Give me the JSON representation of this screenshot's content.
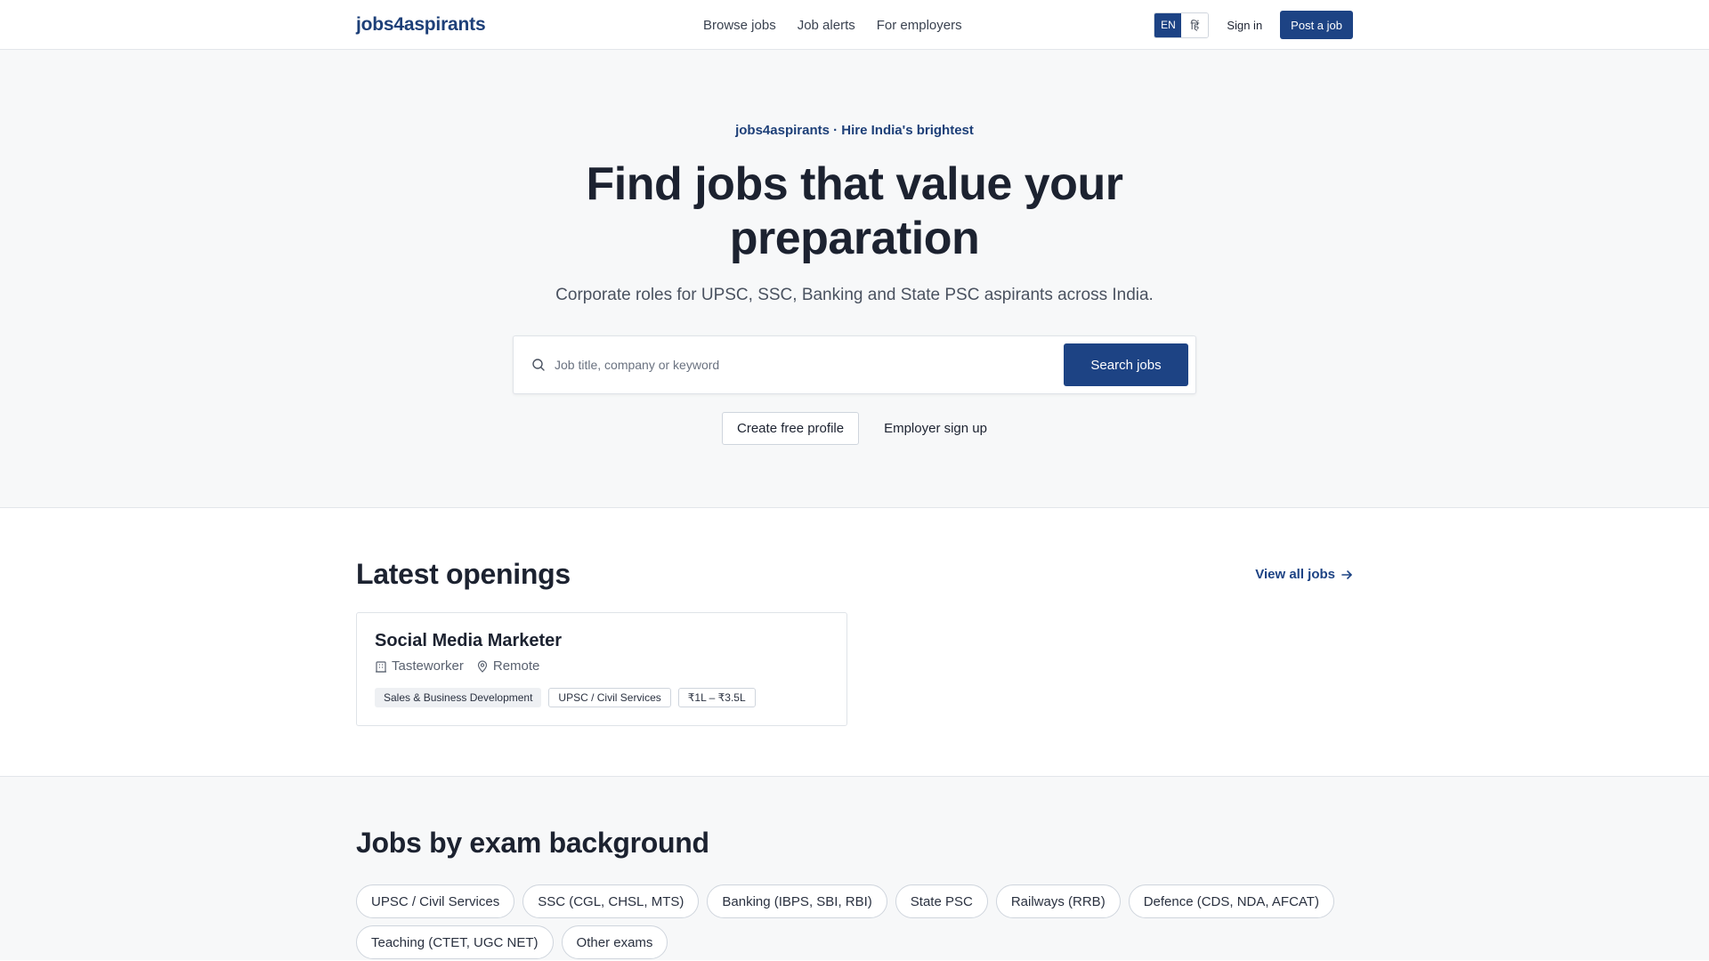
{
  "header": {
    "logo": "jobs4aspirants",
    "nav": [
      "Browse jobs",
      "Job alerts",
      "For employers"
    ],
    "lang_en": "EN",
    "lang_hi": "हिं",
    "signin": "Sign in",
    "post_job": "Post a job"
  },
  "hero": {
    "eyebrow": "jobs4aspirants · Hire India's brightest",
    "title": "Find jobs that value your preparation",
    "subtitle": "Corporate roles for UPSC, SSC, Banking and State PSC aspirants across India.",
    "search_placeholder": "Job title, company or keyword",
    "search_button": "Search jobs",
    "create_profile": "Create free profile",
    "employer_signup": "Employer sign up"
  },
  "latest": {
    "title": "Latest openings",
    "view_all": "View all jobs",
    "jobs": [
      {
        "title": "Social Media Marketer",
        "company": "Tasteworker",
        "location": "Remote",
        "tags": [
          "Sales & Business Development",
          "UPSC / Civil Services",
          "₹1L – ₹3.5L"
        ]
      }
    ]
  },
  "exams": {
    "title": "Jobs by exam background",
    "chips": [
      "UPSC / Civil Services",
      "SSC (CGL, CHSL, MTS)",
      "Banking (IBPS, SBI, RBI)",
      "State PSC",
      "Railways (RRB)",
      "Defence (CDS, NDA, AFCAT)",
      "Teaching (CTET, UGC NET)",
      "Other exams"
    ]
  },
  "colors": {
    "brand": "#1d4384",
    "text": "#1c2230",
    "muted_bg": "#f7f8f9"
  }
}
